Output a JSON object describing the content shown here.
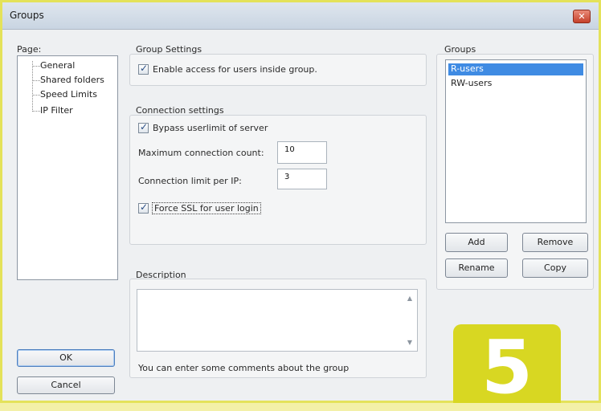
{
  "window": {
    "title": "Groups",
    "close_glyph": "✕"
  },
  "page_panel": {
    "label": "Page:",
    "items": [
      "General",
      "Shared folders",
      "Speed Limits",
      "IP Filter"
    ]
  },
  "group_settings": {
    "title": "Group Settings",
    "enable_access_label": "Enable access for users inside group.",
    "enable_access_checked": true
  },
  "connection_settings": {
    "title": "Connection settings",
    "bypass_label": "Bypass userlimit of server",
    "bypass_checked": true,
    "max_conn_label": "Maximum connection count:",
    "max_conn_value": "10",
    "limit_ip_label": "Connection limit per IP:",
    "limit_ip_value": "3",
    "force_ssl_label": "Force SSL for user login",
    "force_ssl_checked": true
  },
  "description": {
    "title": "Description",
    "hint": "You can enter some comments about the group"
  },
  "groups_panel": {
    "title": "Groups",
    "items": [
      "R-users",
      "RW-users"
    ],
    "selected": "R-users",
    "add_label": "Add",
    "remove_label": "Remove",
    "rename_label": "Rename",
    "copy_label": "Copy"
  },
  "footer": {
    "ok_label": "OK",
    "cancel_label": "Cancel"
  },
  "step_badge": "5",
  "icons": {
    "check": "check-icon",
    "close": "close-icon",
    "scroll_up": "scroll-up-icon",
    "scroll_down": "scroll-down-icon"
  },
  "colors": {
    "selection": "#3f8be3",
    "badge": "#d8d722",
    "frame": "#e4e25a"
  }
}
